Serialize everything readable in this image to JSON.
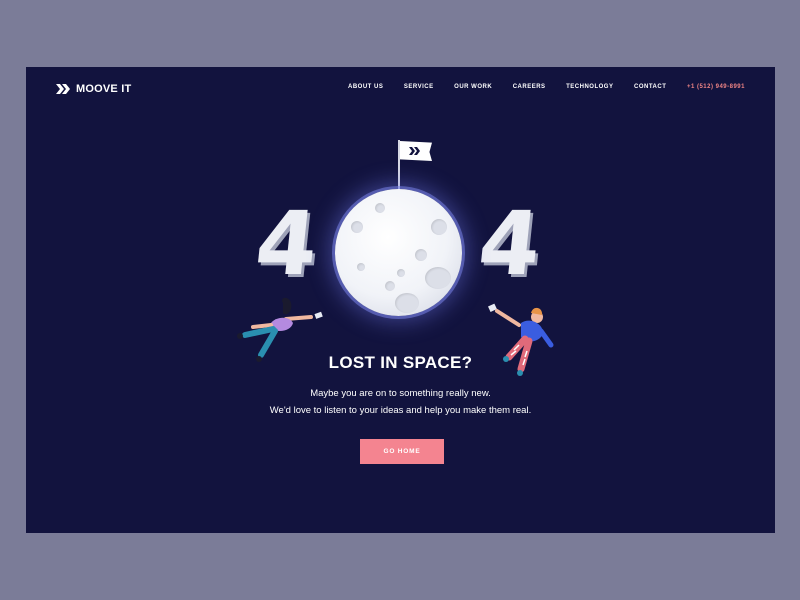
{
  "header": {
    "logo_text": "MOOVE IT",
    "nav": [
      {
        "label": "ABOUT US"
      },
      {
        "label": "SERVICE"
      },
      {
        "label": "OUR WORK"
      },
      {
        "label": "CAREERS"
      },
      {
        "label": "TECHNOLOGY"
      },
      {
        "label": "CONTACT"
      }
    ],
    "phone": "+1 (512) 949-8991"
  },
  "error": {
    "digit_left": "4",
    "digit_right": "4",
    "title": "LOST IN SPACE?",
    "line1": "Maybe you are on to something really new.",
    "line2": "We'd love to listen to your ideas and help you make them real.",
    "button": "GO HOME"
  },
  "colors": {
    "outer_background": "#7b7c98",
    "page_background": "#12133e",
    "accent": "#f48490",
    "phone_text": "#f08585"
  },
  "icons": {
    "logo": "double-chevron-arrow-icon",
    "flag": "moon-flag-icon"
  }
}
